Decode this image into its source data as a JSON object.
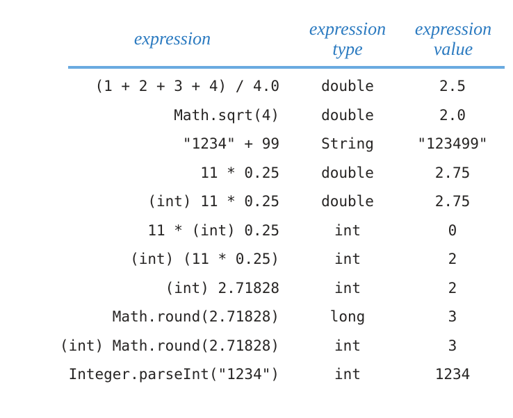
{
  "figure": {
    "kind": "static-table-figure",
    "background_color": "#ffffff",
    "rule_color": "#6aaae0",
    "header_color": "#2b7ac0",
    "body_text_color": "#262423"
  },
  "table": {
    "columns": [
      {
        "key": "expression",
        "label": "expression",
        "align": "right"
      },
      {
        "key": "type",
        "label": "expression\ntype",
        "align": "center"
      },
      {
        "key": "value",
        "label": "expression\nvalue",
        "align": "center"
      }
    ],
    "rows": [
      {
        "expression": "(1 + 2 + 3 + 4) / 4.0",
        "type": "double",
        "value": "2.5"
      },
      {
        "expression": "Math.sqrt(4)",
        "type": "double",
        "value": "2.0"
      },
      {
        "expression": "\"1234\" + 99",
        "type": "String",
        "value": "\"123499\""
      },
      {
        "expression": "11 * 0.25",
        "type": "double",
        "value": "2.75"
      },
      {
        "expression": "(int) 11 * 0.25",
        "type": "double",
        "value": "2.75"
      },
      {
        "expression": "11 * (int) 0.25",
        "type": "int",
        "value": "0"
      },
      {
        "expression": "(int) (11 * 0.25)",
        "type": "int",
        "value": "2"
      },
      {
        "expression": "(int) 2.71828",
        "type": "int",
        "value": "2"
      },
      {
        "expression": "Math.round(2.71828)",
        "type": "long",
        "value": "3"
      },
      {
        "expression": "(int) Math.round(2.71828)",
        "type": "int",
        "value": "3"
      },
      {
        "expression": "Integer.parseInt(\"1234\")",
        "type": "int",
        "value": "1234"
      }
    ]
  },
  "caption": {
    "text": ""
  }
}
